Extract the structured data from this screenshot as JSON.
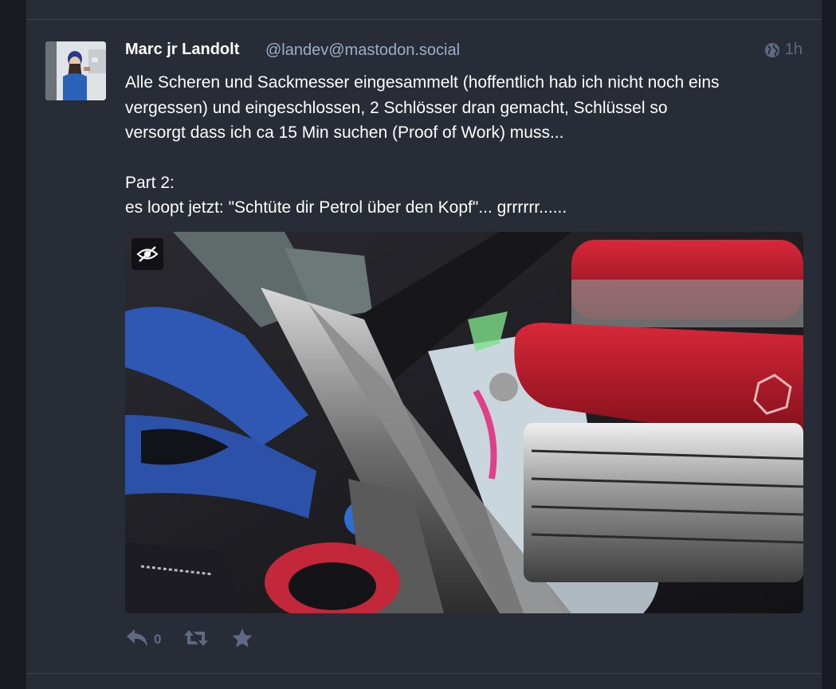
{
  "status": {
    "display_name": "Marc jr Landolt",
    "handle": "@landev@mastodon.social",
    "visibility_icon": "globe-icon",
    "timestamp": "1h",
    "content": {
      "paragraph1_line1": "Alle Scheren und Sackmesser eingesammelt (hoffentlich hab ich nicht noch eins",
      "paragraph1_line2": "vergessen) und eingeschlossen, 2 Schlösser dran gemacht, Schlüssel so",
      "paragraph1_line3": "versorgt dass ich ca 15 Min suchen (Proof of Work)  muss...",
      "paragraph2_line1": "Part 2:",
      "paragraph2_line2": "es loopt jetzt: \"Schtüte dir Petrol über den Kopf\"... grrrrrr......"
    },
    "media": {
      "hide_icon": "eye-slash-icon"
    },
    "actions": {
      "reply_icon": "reply-icon",
      "reply_count": "0",
      "boost_icon": "retweet-icon",
      "favourite_icon": "star-icon"
    }
  },
  "colors": {
    "background": "#191b22",
    "column": "#282c37",
    "text": "#ffffff",
    "secondary": "#9baec8",
    "muted": "#606984"
  }
}
